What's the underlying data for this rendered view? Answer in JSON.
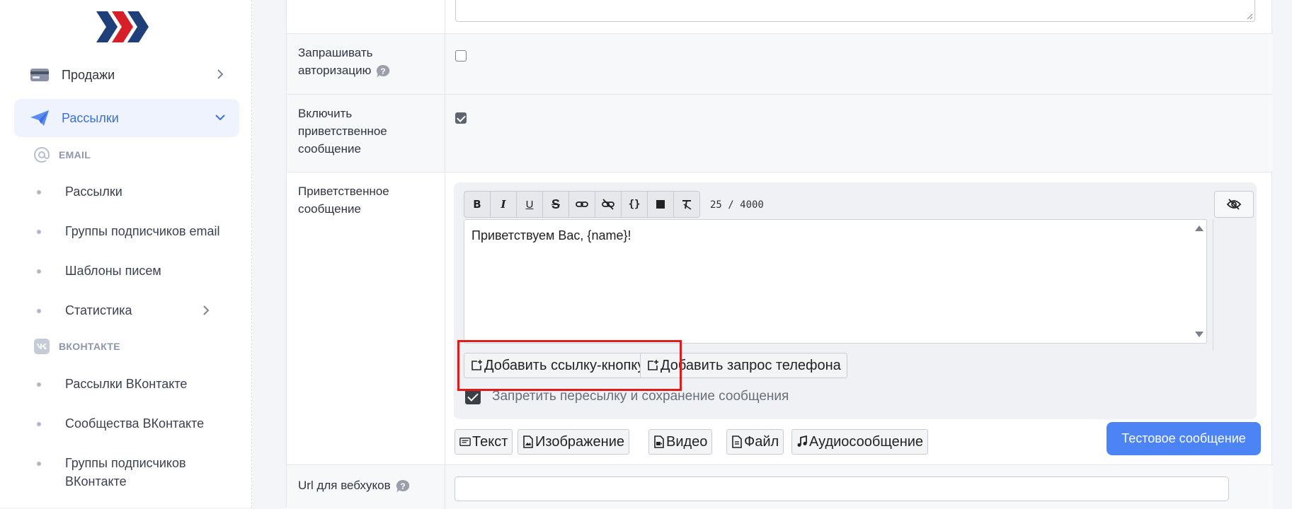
{
  "sidebar": {
    "nav": [
      {
        "label": "Продажи",
        "icon": "credit-card-icon"
      },
      {
        "label": "Рассылки",
        "icon": "paper-plane-icon",
        "active": true
      }
    ],
    "sections": [
      {
        "title": "EMAIL",
        "icon": "at-sign-icon",
        "items": [
          "Рассылки",
          "Группы подписчиков email",
          "Шаблоны писем",
          "Статистика"
        ]
      },
      {
        "title": "ВКОНТАКТЕ",
        "icon": "vk-icon",
        "items": [
          "Рассылки ВКонтакте",
          "Сообщества ВКонтакте",
          "Группы подписчиков ВКонтакте"
        ]
      }
    ]
  },
  "form": {
    "ask_auth": {
      "label": "Запрашивать авторизацию",
      "checked": false
    },
    "welcome_enable": {
      "label": "Включить приветственное сообщение",
      "checked": true
    },
    "welcome_message": {
      "label": "Приветственное сообщение",
      "toolbar": [
        "B",
        "I",
        "U",
        "S",
        "link",
        "unlink",
        "{}",
        "block",
        "clear-format"
      ],
      "counter": "25 / 4000",
      "text": "Приветствуем Вас, {name}!",
      "add_link_button": "Добавить ссылку-кнопку",
      "add_phone_button": "Добавить запрос телефона",
      "forbid_forward": {
        "label": "Запретить пересылку и сохранение сообщения",
        "checked": true
      },
      "types": [
        "Текст",
        "Изображение",
        "Видео",
        "Файл",
        "Аудиосообщение"
      ],
      "test_button": "Тестовое сообщение"
    },
    "webhook": {
      "label": "Url для вебхуков",
      "value": ""
    }
  },
  "colors": {
    "accent": "#4c84f6",
    "active_nav": "#3c6fe0",
    "highlight": "#e01b1b"
  }
}
